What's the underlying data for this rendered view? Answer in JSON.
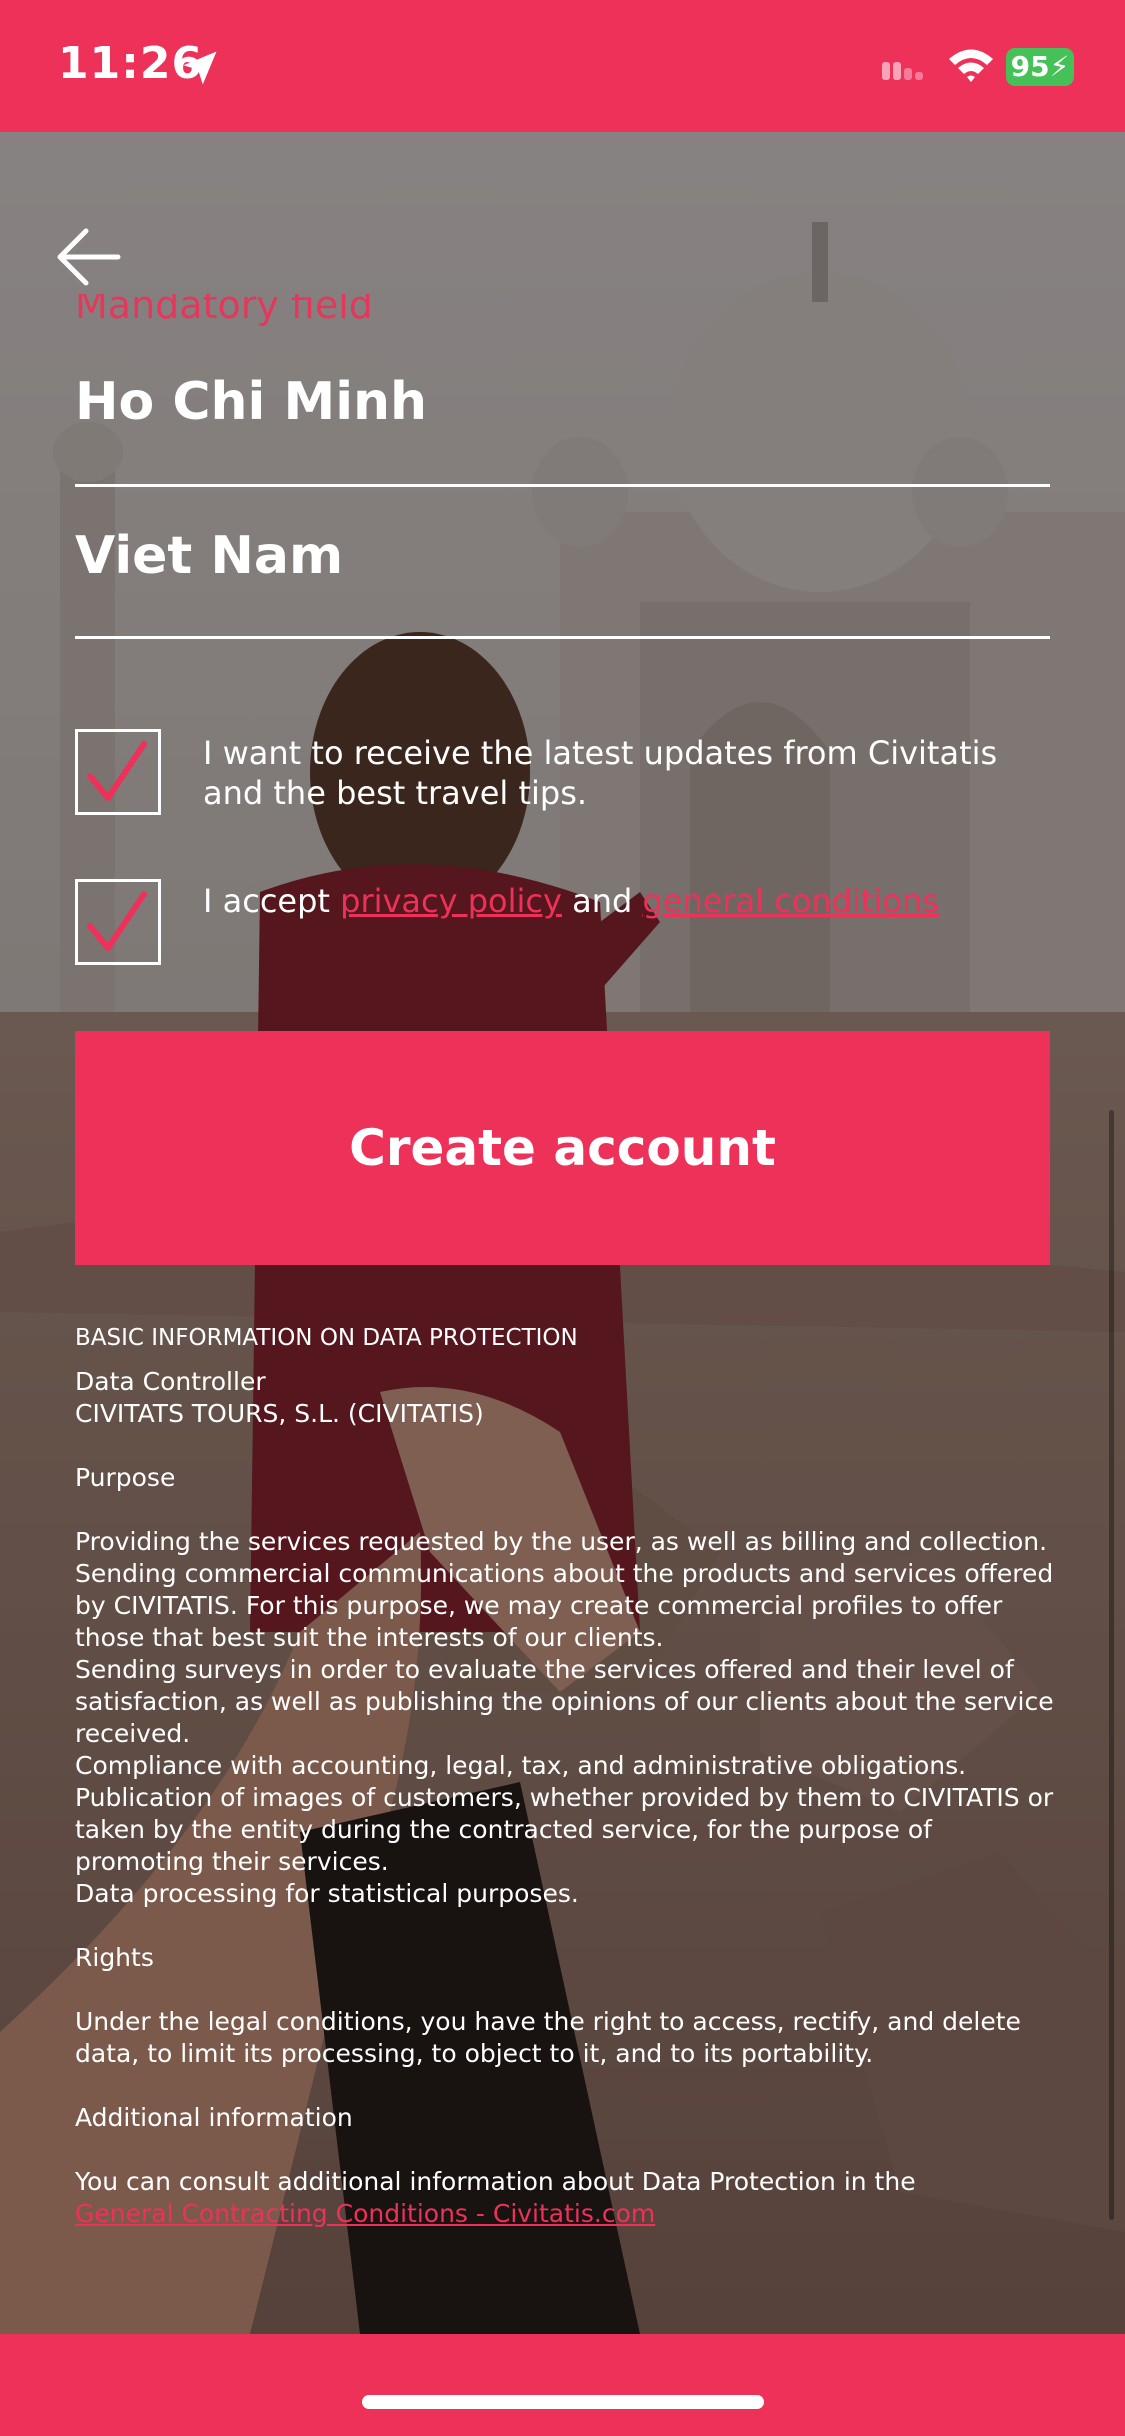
{
  "status": {
    "time": "11:26",
    "battery": "95"
  },
  "form": {
    "mandatory_label": "Mandatory field",
    "city_value": "Ho Chi Minh",
    "country_value": "Viet Nam",
    "newsletter_checked": true,
    "newsletter_text": "I want to receive the latest updates from Civitatis and the best travel tips.",
    "terms_checked": true,
    "terms_prefix": "I accept ",
    "terms_privacy_link": "privacy policy",
    "terms_and": " and ",
    "terms_conditions_link": "general conditions",
    "create_button": "Create account"
  },
  "legal": {
    "title": "BASIC INFORMATION ON DATA PROTECTION",
    "controller_label": "Data Controller",
    "controller_value": "CIVITATS TOURS, S.L. (CIVITATIS)",
    "purpose_label": "Purpose",
    "purpose_items": [
      "Providing the services requested by the user, as well as billing and collection.",
      "Sending commercial communications about the products and services offered by CIVITATIS. For this purpose, we may create commercial profiles to offer those that best suit the interests of our clients.",
      "Sending surveys in order to evaluate the services offered and their level of satisfaction, as well as publishing the opinions of our clients about the service received.",
      "Compliance with accounting, legal, tax, and administrative obligations.",
      "Publication of images of customers, whether provided by them to CIVITATIS or taken by the entity during the contracted service, for the purpose of promoting their services.",
      "Data processing for statistical purposes."
    ],
    "rights_label": "Rights",
    "rights_text": "Under the legal conditions, you have the right to access, rectify, and delete data, to limit its processing, to object to it, and to its portability.",
    "additional_label": "Additional information",
    "additional_text": "You can consult additional information about Data Protection in the",
    "additional_link": "General Contracting Conditions - Civitatis.com"
  },
  "colors": {
    "brand": "#ee3159",
    "battery": "#45c157"
  }
}
